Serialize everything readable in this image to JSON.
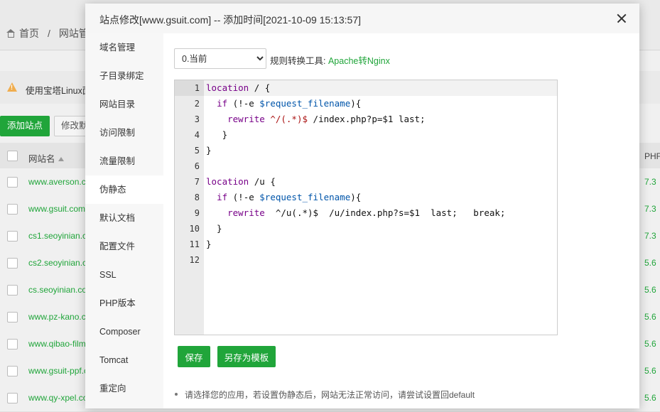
{
  "background": {
    "breadcrumb": {
      "home": "首页",
      "separator": "/",
      "current": "网站管"
    },
    "notice": "使用宝塔Linux面",
    "buttons": {
      "add_site": "添加站点",
      "modify": "修改默"
    },
    "table": {
      "col_name": "网站名",
      "col_php": "PHF",
      "rows": [
        {
          "site": "www.averson.c",
          "php": "7.3"
        },
        {
          "site": "www.gsuit.com",
          "php": "7.3"
        },
        {
          "site": "cs1.seoyinian.c",
          "php": "7.3"
        },
        {
          "site": "cs2.seoyinian.c",
          "php": "5.6"
        },
        {
          "site": "cs.seoyinian.co",
          "php": "5.6"
        },
        {
          "site": "www.pz-kano.c",
          "php": "5.6"
        },
        {
          "site": "www.qibao-film",
          "php": "5.6"
        },
        {
          "site": "www.gsuit-ppf.c",
          "php": "5.6"
        },
        {
          "site": "www.qy-xpel.co",
          "php": "5.6"
        }
      ]
    }
  },
  "modal": {
    "title": "站点修改[www.gsuit.com] -- 添加时间[2021-10-09 15:13:57]",
    "sidebar": [
      "域名管理",
      "子目录绑定",
      "网站目录",
      "访问限制",
      "流量限制",
      "伪静态",
      "默认文档",
      "配置文件",
      "SSL",
      "PHP版本",
      "Composer",
      "Tomcat",
      "重定向"
    ],
    "active_tab": "伪静态",
    "version_select": {
      "value": "0.当前",
      "options": [
        "0.当前"
      ]
    },
    "rule_tool_label": "规则转换工具:",
    "rule_tool_link": "Apache转Nginx",
    "editor": {
      "line_numbers": [
        "1",
        "2",
        "3",
        "4",
        "5",
        "6",
        "7",
        "8",
        "9",
        "10",
        "11",
        "12"
      ],
      "lines": [
        "location / {",
        "  if (!-e $request_filename){",
        "    rewrite ^/(.*)$ /index.php?p=$1 last;",
        "   }",
        "}",
        "",
        "location /u {",
        "  if (!-e $request_filename){",
        "    rewrite  ^/u(.*)$  /u/index.php?s=$1  last;   break;",
        "  }",
        "}",
        ""
      ]
    },
    "save_button": "保存",
    "save_template_button": "另存为模板",
    "tip": "请选择您的应用，若设置伪静态后，网站无法正常访问，请尝试设置回default"
  }
}
